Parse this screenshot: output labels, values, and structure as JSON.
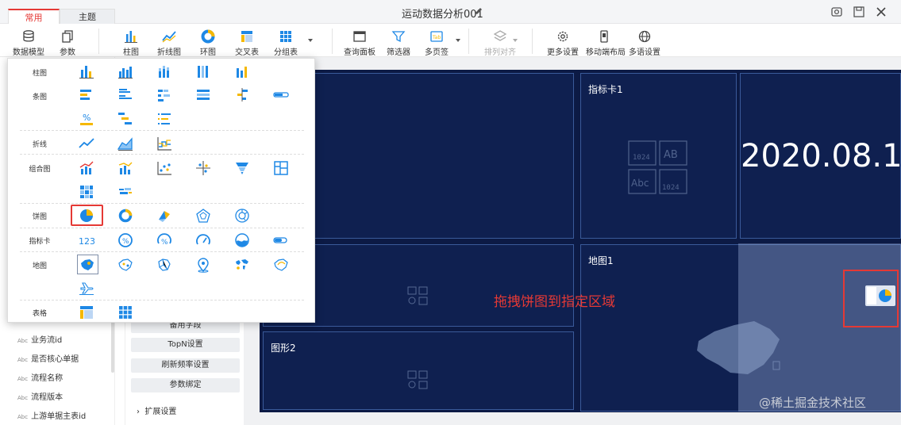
{
  "tabs": [
    "常用",
    "主题"
  ],
  "title": "运动数据分析001",
  "window_icons": [
    "capture-icon",
    "save-icon",
    "close-icon"
  ],
  "toolbar": {
    "items": [
      {
        "label": "数据模型",
        "icon": "database-icon"
      },
      {
        "label": "参数",
        "icon": "copy-icon"
      },
      {
        "label": "柱图",
        "icon": "bar-chart-icon"
      },
      {
        "label": "折线图",
        "icon": "line-chart-icon"
      },
      {
        "label": "环图",
        "icon": "ring-chart-icon"
      },
      {
        "label": "交叉表",
        "icon": "crosstab-icon"
      },
      {
        "label": "分组表",
        "icon": "group-table-icon"
      },
      {
        "label": "查询面板",
        "icon": "query-panel-icon"
      },
      {
        "label": "筛选器",
        "icon": "filter-icon"
      },
      {
        "label": "多页签",
        "icon": "tab-icon"
      },
      {
        "label": "排列对齐",
        "icon": "layers-icon"
      },
      {
        "label": "更多设置",
        "icon": "gear-icon"
      },
      {
        "label": "移动端布局",
        "icon": "mobile-icon"
      },
      {
        "label": "多语设置",
        "icon": "globe-icon"
      }
    ]
  },
  "left_fields": [
    "业务流id",
    "是否核心单据",
    "流程名称",
    "流程版本",
    "上游单据主表id"
  ],
  "mid_buttons": [
    "备用字段",
    "TopN设置",
    "刷新频率设置",
    "参数绑定"
  ],
  "expand_label": "扩展设置",
  "canvas": {
    "panel_kpi_title": "指标卡1",
    "big_date": "2020.08.1",
    "panel_shape2_title": "图形2",
    "panel_map_title": "地图1",
    "drag_tip": "拖拽饼图到指定区域"
  },
  "watermark": "@稀土掘金技术社区",
  "gallery": {
    "rows": [
      {
        "label": "柱图"
      },
      {
        "label": "条图"
      },
      {
        "label": "折线"
      },
      {
        "label": "组合图"
      },
      {
        "label": "饼图"
      },
      {
        "label": "指标卡"
      },
      {
        "label": "地图"
      },
      {
        "label": "表格"
      }
    ],
    "kpi_sample_number": "123",
    "kpi_sample_percent": "%"
  },
  "colors": {
    "accent": "#e53935",
    "canvas": "#0c1a45",
    "icon_blue": "#1e88e5",
    "icon_yellow": "#f5b800"
  }
}
